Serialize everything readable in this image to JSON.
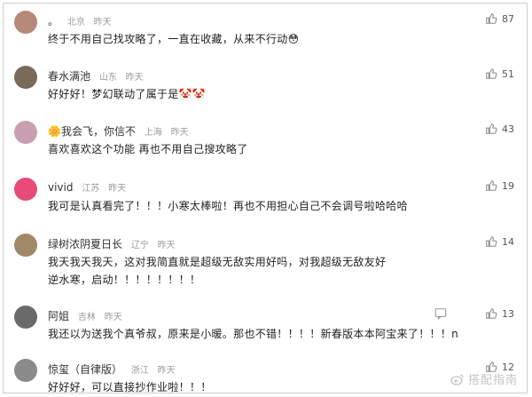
{
  "comments": [
    {
      "name": "。",
      "location": "北京",
      "time": "昨天",
      "text": "终于不用自己找攻略了，一直在收藏，从来不行动",
      "emoji": "😳",
      "likes": "87",
      "avatar_color": "#b58a7a"
    },
    {
      "name": "春水满池",
      "location": "山东",
      "time": "昨天",
      "text": "好好好！梦幻联动了属于是",
      "emoji": "🤡🤡",
      "likes": "51",
      "avatar_color": "#7a6a5a"
    },
    {
      "name": "🌼我会飞，你信不",
      "location": "上海",
      "time": "昨天",
      "text": "喜欢喜欢这个功能 再也不用自己搜攻略了",
      "emoji": "",
      "likes": "43",
      "avatar_color": "#c9a0b0"
    },
    {
      "name": "vivid",
      "location": "江苏",
      "time": "昨天",
      "text": "我可是认真看完了！！！小寒太棒啦！再也不用担心自己不会调号啦哈哈哈",
      "emoji": "",
      "likes": "19",
      "avatar_color": "#e84b7a"
    },
    {
      "name": "绿树浓阴夏日长",
      "location": "辽宁",
      "time": "昨天",
      "text": "我天我天我天，这对我简直就是超级无敌实用好吗，对我超级无敌友好",
      "text2": "逆水寒，启动！！！！！！！！",
      "emoji": "",
      "likes": "14",
      "avatar_color": "#a08868"
    },
    {
      "name": "阿姐",
      "location": "吉林",
      "time": "昨天",
      "text": "我还以为送我个真爷叔，原来是小暖。那也不错！！！！新春版本本阿宝来了！！！n",
      "emoji": "",
      "likes": "13",
      "avatar_color": "#6a6a6a"
    },
    {
      "name": "惊玺（自律版）",
      "location": "浙江",
      "time": "昨天",
      "text": "好好好，可以直接抄作业啦！！！",
      "emoji": "",
      "likes": "12",
      "avatar_color": "#8a8a8a"
    }
  ],
  "watermark": "搭配指南",
  "colors": {
    "text": "#222222",
    "meta": "#9a9a9a",
    "border": "#d0d0d0"
  },
  "icons": {
    "like": "thumbs-up-icon",
    "reply": "reply-icon"
  }
}
